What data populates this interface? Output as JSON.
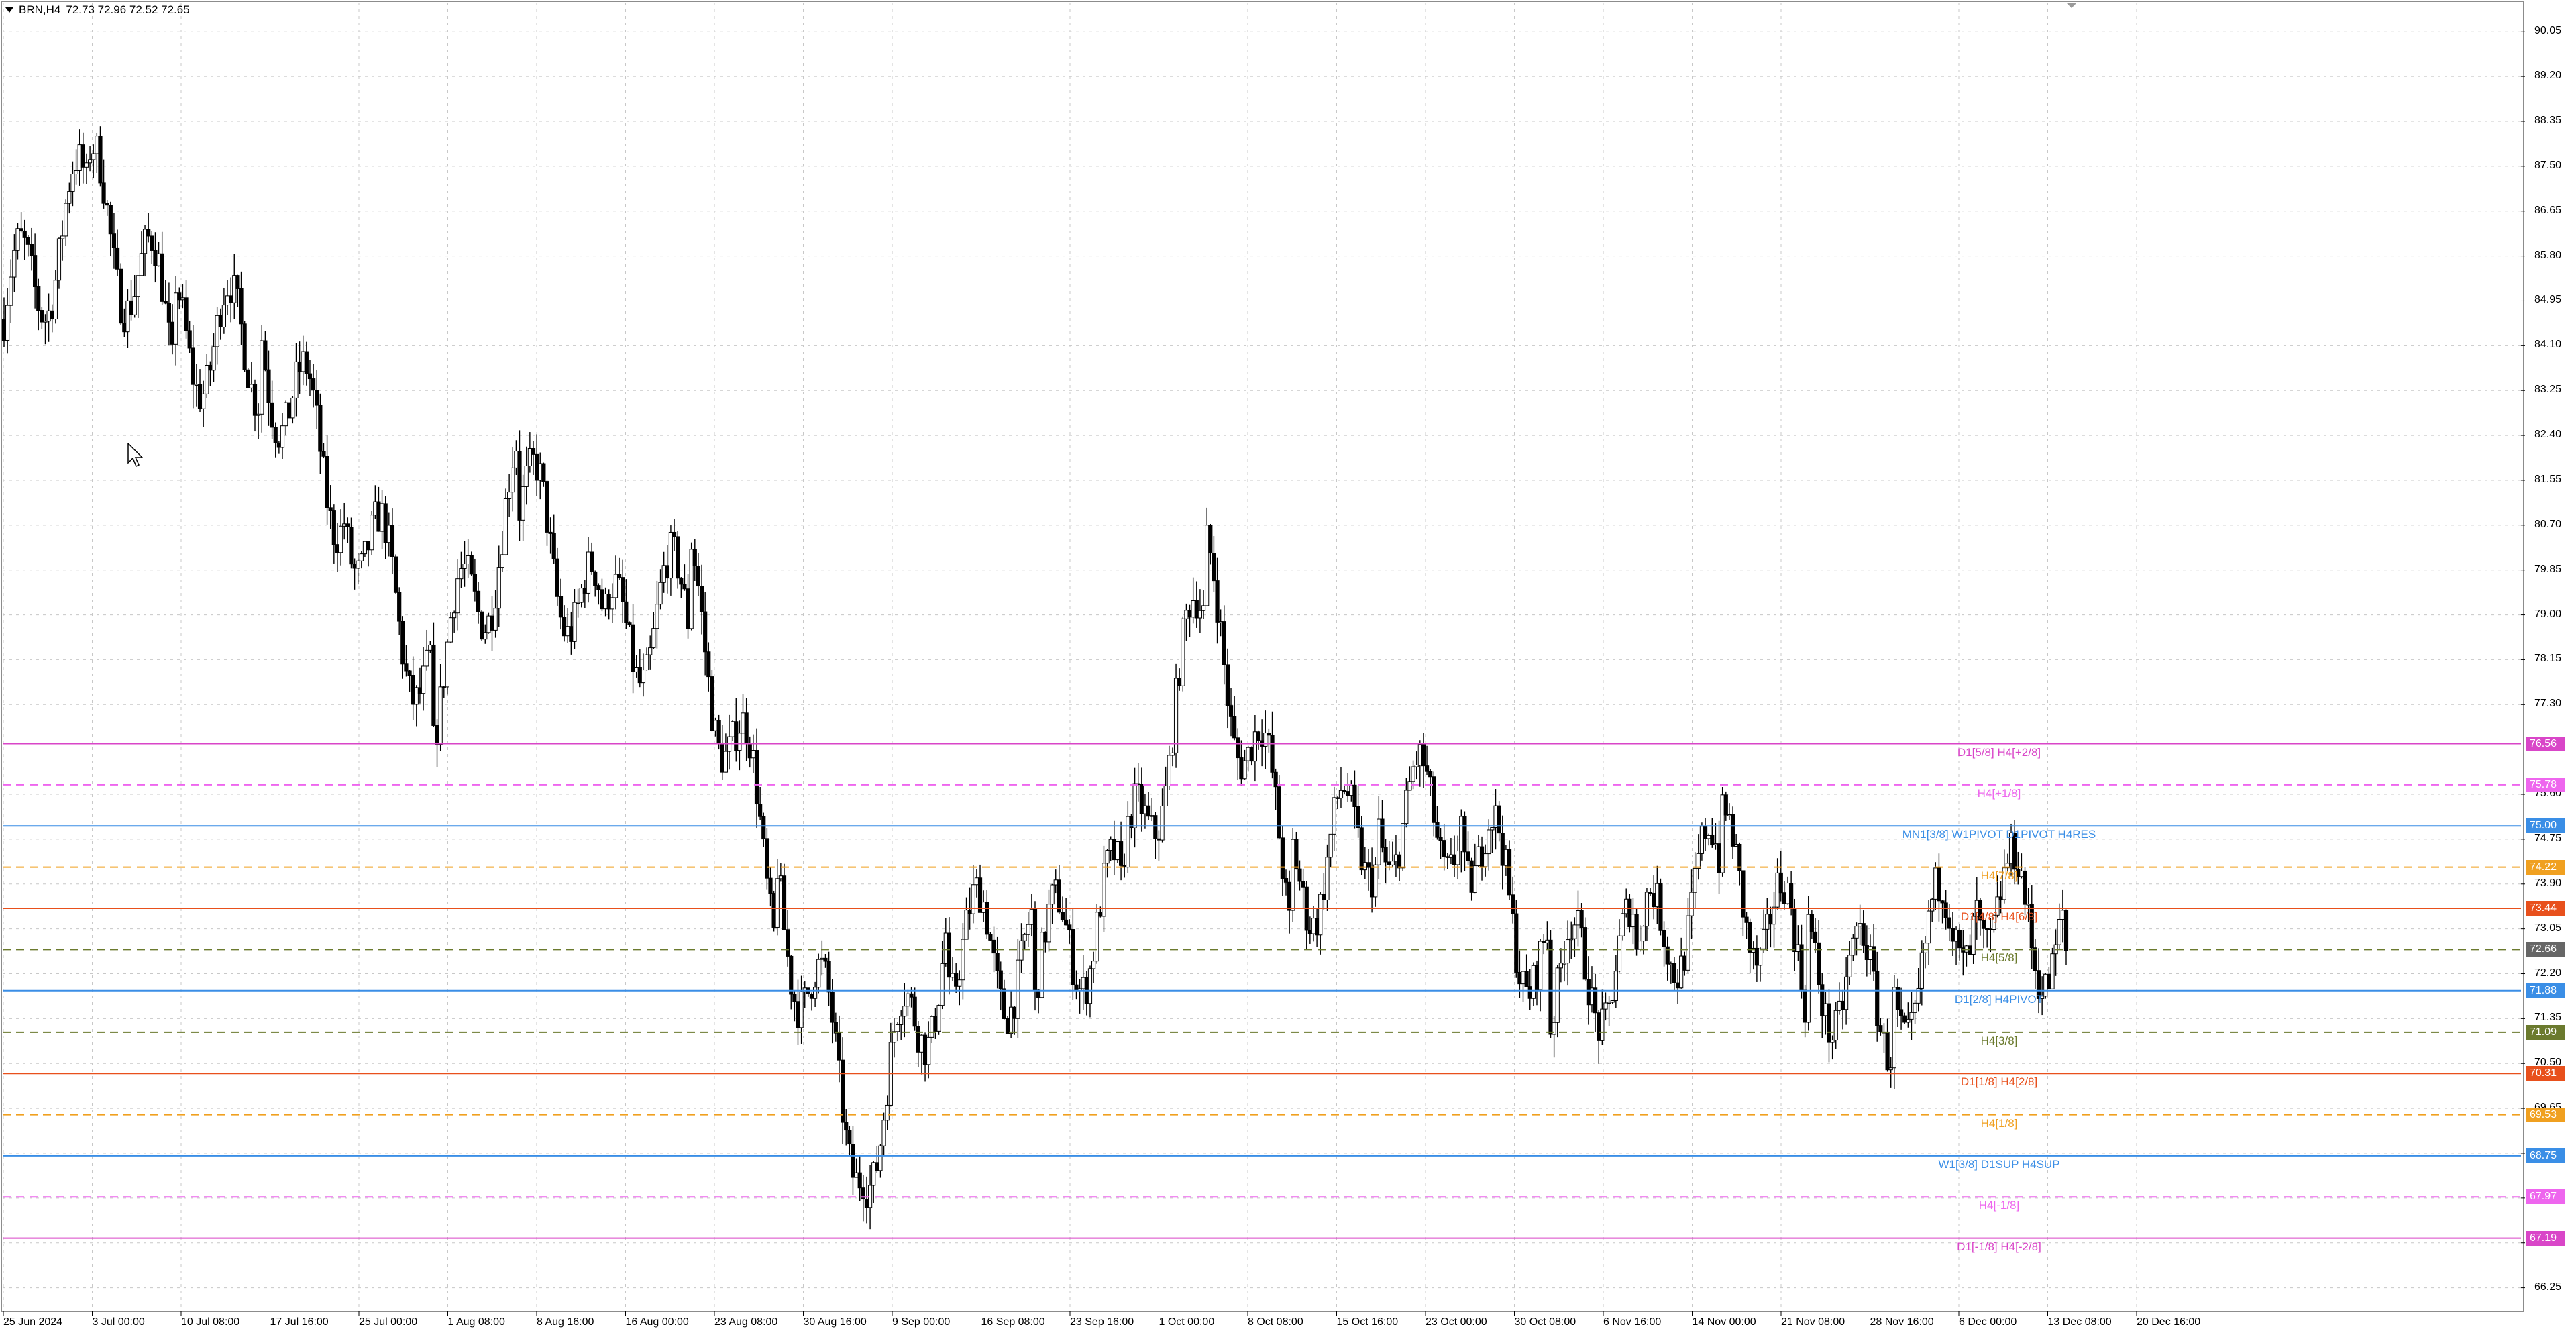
{
  "header": {
    "symbol": "BRN,H4",
    "ohlc": "72.73 72.96 72.52 72.65"
  },
  "colors": {
    "background": "#ffffff",
    "grid": "#c8c8c8",
    "candle": "#000000",
    "magenta": "#d946c8",
    "pink": "#ee66ee",
    "blue": "#3a8ee6",
    "orange": "#f0a020",
    "red": "#e8501c",
    "olive": "#6b7a2e",
    "gray": "#888888"
  },
  "price_axis": {
    "ticks": [
      "90.05",
      "89.20",
      "88.35",
      "87.50",
      "86.65",
      "85.80",
      "84.95",
      "84.10",
      "83.25",
      "82.40",
      "81.55",
      "80.70",
      "79.85",
      "79.00",
      "78.15",
      "77.30",
      "75.60",
      "74.75",
      "73.90",
      "73.05",
      "72.20",
      "71.35",
      "70.50",
      "69.65",
      "68.80",
      "67.95",
      "67.10",
      "66.25"
    ]
  },
  "time_axis": {
    "labels": [
      "25 Jun 2024",
      "3 Jul 00:00",
      "10 Jul 08:00",
      "17 Jul 16:00",
      "25 Jul 00:00",
      "1 Aug 08:00",
      "8 Aug 16:00",
      "16 Aug 00:00",
      "23 Aug 08:00",
      "30 Aug 16:00",
      "9 Sep 00:00",
      "16 Sep 08:00",
      "23 Sep 16:00",
      "1 Oct 00:00",
      "8 Oct 08:00",
      "15 Oct 16:00",
      "23 Oct 00:00",
      "30 Oct 08:00",
      "6 Nov 16:00",
      "14 Nov 00:00",
      "21 Nov 08:00",
      "28 Nov 16:00",
      "6 Dec 00:00",
      "13 Dec 08:00",
      "20 Dec 16:00"
    ]
  },
  "levels": [
    {
      "label": "D1[5/8] H4[+2/8]",
      "price": "76.56",
      "color": "#d946c8",
      "dash": false,
      "badge": "#d946c8"
    },
    {
      "label": "H4[+1/8]",
      "price": "75.78",
      "color": "#ee66ee",
      "dash": true,
      "badge": "#ee66ee"
    },
    {
      "label": "MN1[3/8] W1PIVOT D1PIVOT H4RES",
      "price": "75.00",
      "color": "#3a8ee6",
      "dash": false,
      "badge": "#3a8ee6"
    },
    {
      "label": "H4[7/8]",
      "price": "74.22",
      "color": "#f0a020",
      "dash": true,
      "badge": "#f0a020"
    },
    {
      "label": "D1[4/8] H4[6/8]",
      "price": "73.44",
      "color": "#e8501c",
      "dash": false,
      "badge": "#e8501c"
    },
    {
      "label": "H4[5/8]",
      "price": "72.66",
      "color": "#6b7a2e",
      "dash": true,
      "badge": "#666666"
    },
    {
      "label": "D1[2/8] H4PIVOT",
      "price": "71.88",
      "color": "#3a8ee6",
      "dash": false,
      "badge": "#3a8ee6"
    },
    {
      "label": "H4[3/8]",
      "price": "71.09",
      "color": "#6b7a2e",
      "dash": true,
      "badge": "#6b7a2e"
    },
    {
      "label": "D1[1/8] H4[2/8]",
      "price": "70.31",
      "color": "#e8501c",
      "dash": false,
      "badge": "#e8501c"
    },
    {
      "label": "H4[1/8]",
      "price": "69.53",
      "color": "#f0a020",
      "dash": true,
      "badge": "#f0a020"
    },
    {
      "label": "W1[3/8] D1SUP H4SUP",
      "price": "68.75",
      "color": "#3a8ee6",
      "dash": false,
      "badge": "#3a8ee6"
    },
    {
      "label": "H4[-1/8]",
      "price": "67.97",
      "color": "#ee66ee",
      "dash": true,
      "badge": "#ee66ee"
    },
    {
      "label": "D1[-1/8] H4[-2/8]",
      "price": "67.19",
      "color": "#d946c8",
      "dash": false,
      "badge": "#d946c8"
    }
  ],
  "chart_data": {
    "type": "candlestick",
    "x": [
      "25 Jun 2024",
      "3 Jul 00:00",
      "10 Jul 08:00",
      "17 Jul 16:00",
      "25 Jul 00:00",
      "1 Aug 08:00",
      "8 Aug 16:00",
      "16 Aug 00:00",
      "23 Aug 08:00",
      "30 Aug 16:00",
      "9 Sep 00:00",
      "16 Sep 08:00",
      "23 Sep 16:00",
      "1 Oct 00:00",
      "8 Oct 08:00",
      "15 Oct 16:00",
      "23 Oct 00:00",
      "30 Oct 08:00",
      "6 Nov 16:00",
      "14 Nov 00:00",
      "21 Nov 08:00",
      "28 Nov 16:00",
      "6 Dec 00:00",
      "13 Dec 08:00",
      "20 Dec 16:00"
    ],
    "close": [
      84.6,
      86.9,
      84.3,
      84.1,
      81.2,
      77.6,
      81.3,
      78.4,
      79.3,
      73.8,
      68.9,
      72.9,
      72.3,
      73.5,
      79.3,
      73.9,
      75.2,
      75.2,
      72.0,
      72.4,
      74.2,
      72.3,
      71.7,
      73.9,
      72.65
    ],
    "last_price": 72.65,
    "ylim": [
      65.8,
      90.6
    ],
    "grid": true
  }
}
